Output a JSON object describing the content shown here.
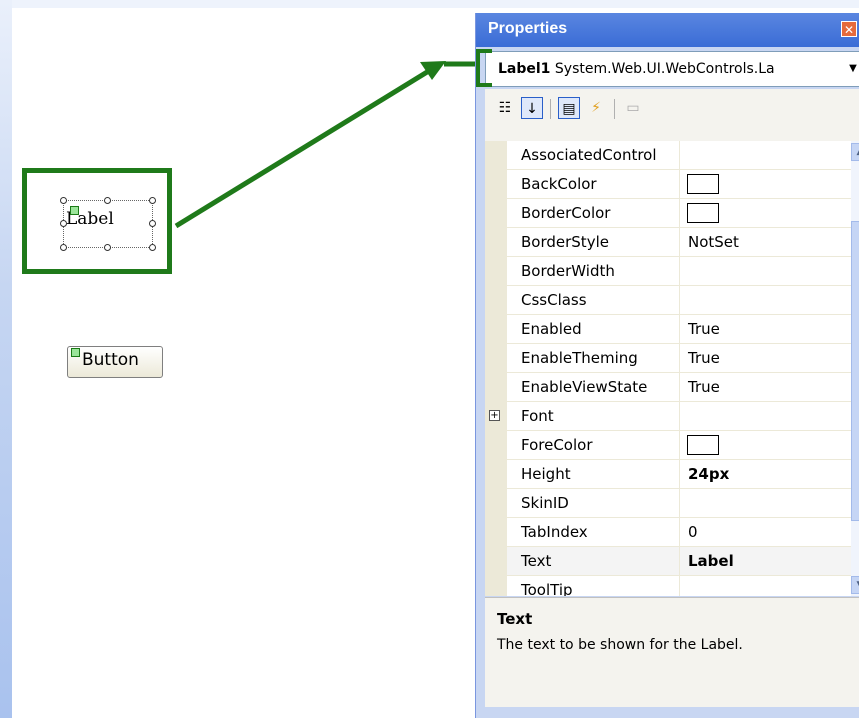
{
  "designer": {
    "label_text": "Label",
    "button_text": "Button"
  },
  "properties": {
    "window_title": "Properties",
    "selector": {
      "name": "Label1",
      "type": "System.Web.UI.WebControls.La"
    },
    "toolbar": {
      "icons": [
        "categorized-icon",
        "alphabetical-icon",
        "properties-icon",
        "events-icon",
        "property-pages-icon"
      ]
    },
    "rows": [
      {
        "name": "AssociatedControl",
        "value": ""
      },
      {
        "name": "BackColor",
        "value": ""
      },
      {
        "name": "BorderColor",
        "value": ""
      },
      {
        "name": "BorderStyle",
        "value": "NotSet"
      },
      {
        "name": "BorderWidth",
        "value": ""
      },
      {
        "name": "CssClass",
        "value": ""
      },
      {
        "name": "Enabled",
        "value": "True"
      },
      {
        "name": "EnableTheming",
        "value": "True"
      },
      {
        "name": "EnableViewState",
        "value": "True"
      },
      {
        "name": "Font",
        "value": ""
      },
      {
        "name": "ForeColor",
        "value": ""
      },
      {
        "name": "Height",
        "value": "24px"
      },
      {
        "name": "SkinID",
        "value": ""
      },
      {
        "name": "TabIndex",
        "value": "0"
      },
      {
        "name": "Text",
        "value": "Label"
      },
      {
        "name": "ToolTip",
        "value": ""
      }
    ],
    "description": {
      "title": "Text",
      "text": "The text to be shown for the Label."
    }
  },
  "colors": {
    "highlight_green": "#1f7a1a",
    "title_bar_blue": "#3a6cd6"
  }
}
